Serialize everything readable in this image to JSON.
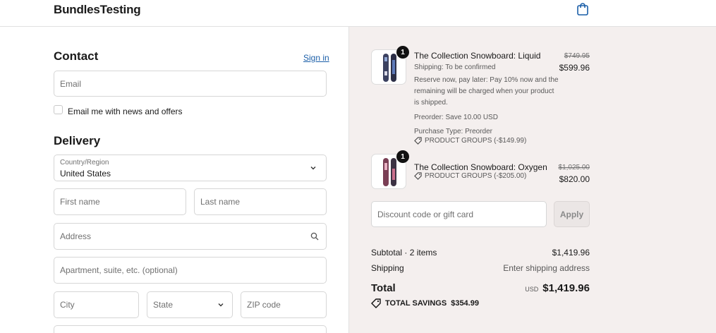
{
  "header": {
    "brand": "BundlesTesting",
    "cart_icon": "shopping-bag-icon"
  },
  "contact": {
    "title": "Contact",
    "sign_in": "Sign in",
    "email_placeholder": "Email",
    "newsletter_label": "Email me with news and offers",
    "newsletter_checked": false
  },
  "delivery": {
    "title": "Delivery",
    "country_label": "Country/Region",
    "country_value": "United States",
    "first_name_placeholder": "First name",
    "last_name_placeholder": "Last name",
    "address_placeholder": "Address",
    "apartment_placeholder": "Apartment, suite, etc. (optional)",
    "city_placeholder": "City",
    "state_placeholder": "State",
    "zip_placeholder": "ZIP code"
  },
  "order": {
    "items": [
      {
        "quantity": "1",
        "name": "The Collection Snowboard: Liquid",
        "shipping": "Shipping: To be confirmed",
        "note": "Reserve now, pay later: Pay 10% now and the remaining will be charged when your product is shipped.",
        "preorder_save": "Preorder: Save 10.00 USD",
        "purchase_type": "Purchase Type: Preorder",
        "discount": "PRODUCT GROUPS (-$149.99)",
        "original_price": "$749.95",
        "price": "$599.96"
      },
      {
        "quantity": "1",
        "name": "The Collection Snowboard: Oxygen",
        "discount": "PRODUCT GROUPS (-$205.00)",
        "original_price": "$1,025.00",
        "price": "$820.00"
      }
    ],
    "discount_placeholder": "Discount code or gift card",
    "apply_label": "Apply",
    "subtotal_label": "Subtotal · 2 items",
    "subtotal_value": "$1,419.96",
    "shipping_label": "Shipping",
    "shipping_value": "Enter shipping address",
    "total_label": "Total",
    "total_currency": "USD",
    "total_value": "$1,419.96",
    "savings_label": "TOTAL SAVINGS",
    "savings_value": "$354.99"
  },
  "colors": {
    "link": "#1a5ea8",
    "summary_bg": "#f4efee",
    "badge_bg": "#111111"
  }
}
